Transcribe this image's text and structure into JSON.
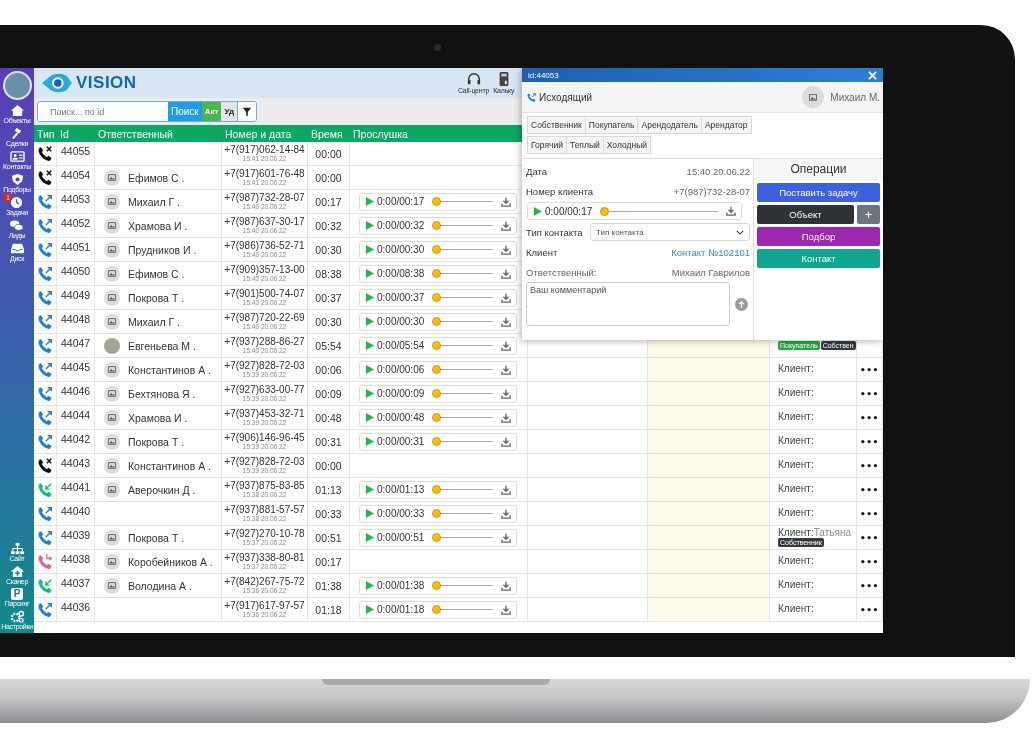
{
  "sidebar": {
    "top_items": [
      {
        "label": "Объекты",
        "kind": "house"
      },
      {
        "label": "Сделки",
        "kind": "hammer"
      },
      {
        "label": "Контакты",
        "kind": "card"
      },
      {
        "label": "Подборы",
        "kind": "shield"
      },
      {
        "label": "Задачи",
        "kind": "clock",
        "badge": "1"
      },
      {
        "label": "Лиды",
        "kind": "chat"
      },
      {
        "label": "Диск",
        "kind": "tray"
      }
    ],
    "bottom_items": [
      {
        "label": "Сайт",
        "kind": "sitemap"
      },
      {
        "label": "Сканер",
        "kind": "house-plus"
      },
      {
        "label": "Парсинг",
        "kind": "letter",
        "glyph": "P"
      },
      {
        "label": "Настройки",
        "kind": "gears"
      }
    ]
  },
  "header": {
    "logo": "VISION",
    "tools": [
      {
        "label": "Call-центр",
        "kind": "headset"
      },
      {
        "label": "Кальку",
        "kind": "calculator"
      }
    ]
  },
  "search": {
    "placeholder": "Поиск... по id",
    "buttons": [
      {
        "label": "Поиск",
        "kind": "search"
      },
      {
        "label": "Акт",
        "kind": "active"
      },
      {
        "label": "Уд",
        "kind": "deleted"
      }
    ]
  },
  "table": {
    "columns": [
      "Тип",
      "Id",
      "Ответственный",
      "Номер и дата",
      "Время",
      "Прослушка"
    ],
    "rows": [
      {
        "kind": "missed",
        "id": "44055",
        "phone": "+7(917)062-14-84",
        "date": "15:41 20.06.22",
        "duration": "00:00"
      },
      {
        "kind": "missed",
        "id": "44054",
        "avatar": {
          "kind": "placeholder"
        },
        "responsible": "Ефимов С .",
        "phone": "+7(917)601-76-48",
        "date": "15:41 20.06.22",
        "duration": "00:00"
      },
      {
        "kind": "outgoing",
        "id": "44053",
        "avatar": {
          "kind": "placeholder"
        },
        "responsible": "Михаил Г .",
        "phone": "+7(987)732-28-07",
        "date": "15:40 20.06.22",
        "duration": "00:17",
        "player": {
          "time": "0:00/00:17",
          "level": 0
        }
      },
      {
        "kind": "outgoing",
        "id": "44052",
        "avatar": {
          "kind": "placeholder"
        },
        "responsible": "Храмова И .",
        "phone": "+7(987)637-30-17",
        "date": "15:40 20.06.22",
        "duration": "00:32",
        "player": {
          "time": "0:00/00:32",
          "level": 0
        }
      },
      {
        "kind": "outgoing",
        "id": "44051",
        "avatar": {
          "kind": "placeholder"
        },
        "responsible": "Прудников И .",
        "phone": "+7(986)736-52-71",
        "date": "15:40 20.06.22",
        "duration": "00:30",
        "player": {
          "time": "0:00/00:30",
          "level": 0
        }
      },
      {
        "kind": "outgoing",
        "id": "44050",
        "avatar": {
          "kind": "placeholder"
        },
        "responsible": "Ефимов С .",
        "phone": "+7(909)357-13-00",
        "date": "15:40 20.06.22",
        "duration": "08:38",
        "player": {
          "time": "0:00/08:38",
          "level": 0
        }
      },
      {
        "kind": "outgoing",
        "id": "44049",
        "avatar": {
          "kind": "placeholder"
        },
        "responsible": "Покрова Т .",
        "phone": "+7(901)500-74-07",
        "date": "15:40 20.06.22",
        "duration": "00:37",
        "player": {
          "time": "0:00/00:37",
          "level": 0
        }
      },
      {
        "kind": "outgoing",
        "id": "44048",
        "avatar": {
          "kind": "placeholder"
        },
        "responsible": "Михаил Г .",
        "phone": "+7(987)720-22-69",
        "date": "15:40 20.06.22",
        "duration": "00:30",
        "player": {
          "time": "0:00/00:30",
          "level": 0
        }
      },
      {
        "kind": "outgoing",
        "id": "44047",
        "avatar": {
          "kind": "photo"
        },
        "responsible": "Евгеньева М .",
        "phone": "+7(937)288-86-27",
        "date": "15:40 20.06.22",
        "duration": "05:54",
        "player": {
          "time": "0:00/05:54",
          "level": 0
        },
        "client": {
          "tags": [
            {
              "text": "Покупатель",
              "color": "#28a745"
            },
            {
              "text": "Собствен",
              "color": "#343a40"
            }
          ]
        }
      },
      {
        "kind": "outgoing",
        "id": "44045",
        "avatar": {
          "kind": "placeholder"
        },
        "responsible": "Константинов А .",
        "phone": "+7(927)828-72-03",
        "date": "15:39 20.06.22",
        "duration": "00:06",
        "player": {
          "time": "0:00/00:06",
          "level": 0
        },
        "client": {
          "label": "Клиент:"
        },
        "menu": "•••"
      },
      {
        "kind": "outgoing",
        "id": "44046",
        "avatar": {
          "kind": "placeholder"
        },
        "responsible": "Бехтянова Я .",
        "phone": "+7(927)633-00-77",
        "date": "15:39 20.06.22",
        "duration": "00:09",
        "player": {
          "time": "0:00/00:09",
          "level": 0
        },
        "client": {
          "label": "Клиент:"
        },
        "menu": "•••"
      },
      {
        "kind": "outgoing",
        "id": "44044",
        "avatar": {
          "kind": "placeholder"
        },
        "responsible": "Храмова И .",
        "phone": "+7(937)453-32-71",
        "date": "15:39 20.06.22",
        "duration": "00:48",
        "player": {
          "time": "0:00/00:48",
          "level": 0
        },
        "client": {
          "label": "Клиент:"
        },
        "menu": "•••"
      },
      {
        "kind": "outgoing",
        "id": "44042",
        "avatar": {
          "kind": "placeholder"
        },
        "responsible": "Покрова Т .",
        "phone": "+7(906)146-96-45",
        "date": "15:39 20.06.22",
        "duration": "00:31",
        "player": {
          "time": "0:00/00:31",
          "level": 0
        },
        "client": {
          "label": "Клиент:"
        },
        "menu": "•••"
      },
      {
        "kind": "missed",
        "id": "44043",
        "avatar": {
          "kind": "placeholder"
        },
        "responsible": "Константинов А .",
        "phone": "+7(927)828-72-03",
        "date": "15:39 20.06.22",
        "duration": "00:00",
        "client": {
          "label": "Клиент:"
        },
        "menu": "•••"
      },
      {
        "kind": "incoming",
        "id": "44041",
        "avatar": {
          "kind": "placeholder"
        },
        "responsible": "Аверочкин Д .",
        "phone": "+7(937)875-83-85",
        "date": "15:38 20.06.22",
        "duration": "01:13",
        "player": {
          "time": "0:00/01:13",
          "level": 0
        },
        "client": {
          "label": "Клиент:"
        },
        "menu": "•••"
      },
      {
        "kind": "outgoing",
        "id": "44040",
        "phone": "+7(937)881-57-57",
        "date": "15:38 20.06.22",
        "duration": "00:33",
        "player": {
          "time": "0:00/00:33",
          "level": 0
        },
        "client": {
          "label": "Клиент:"
        },
        "menu": "•••"
      },
      {
        "kind": "outgoing",
        "id": "44039",
        "avatar": {
          "kind": "placeholder"
        },
        "responsible": "Покрова Т .",
        "phone": "+7(927)270-10-78",
        "date": "15:37 20.06.22",
        "duration": "00:51",
        "player": {
          "time": "0:00/00:51",
          "level": 0
        },
        "client": {
          "label": "Клиент:",
          "name": "Татьяна",
          "tags": [
            {
              "text": "Собственник",
              "color": "#343a40"
            }
          ]
        },
        "menu": "•••"
      },
      {
        "kind": "redirected",
        "id": "44038",
        "avatar": {
          "kind": "placeholder"
        },
        "responsible": "Коробейников А .",
        "phone": "+7(937)338-80-81",
        "date": "15:37 20.06.22",
        "duration": "00:17",
        "client": {
          "label": "Клиент:"
        },
        "menu": "•••"
      },
      {
        "kind": "incoming",
        "id": "44037",
        "avatar": {
          "kind": "placeholder"
        },
        "responsible": "Володина А .",
        "phone": "+7(842)267-75-72",
        "date": "15:36 20.06.22",
        "duration": "01:38",
        "player": {
          "time": "0:00/01:38",
          "level": 0
        },
        "client": {
          "label": "Клиент:"
        },
        "menu": "•••"
      },
      {
        "kind": "outgoing",
        "id": "44036",
        "phone": "+7(917)617-97-57",
        "date": "15:36 20.06.22",
        "duration": "01:18",
        "player": {
          "time": "0:00/01:18",
          "level": 0
        },
        "client": {
          "label": "Клиент:"
        },
        "menu": "•••"
      }
    ]
  },
  "call_card": {
    "title": "id:44053",
    "direction": "Исходящий",
    "agent": "Михаил М.",
    "tag_rows": [
      [
        "Собственник",
        "Покупатель",
        "Арендодатель",
        "Арендатор"
      ],
      [
        "Горячий",
        "Теплый",
        "Холодный"
      ]
    ],
    "date": {
      "label": "Дата",
      "value": "15:40 20.06.22"
    },
    "number": {
      "label": "Номер клиента",
      "value": "+7(987)732-28-07"
    },
    "player": {
      "time": "0:00/00:17",
      "level": 0
    },
    "contact_type": {
      "label": "Тип контакта",
      "placeholder": "Тип контакта"
    },
    "client": {
      "label": "Клиент",
      "link": "Контакт №102101"
    },
    "responsible": {
      "label": "Ответственный:",
      "value": "Михаил Гаврилов"
    },
    "comment": {
      "placeholder": "Ваш комментарий"
    },
    "operations": {
      "title": "Операции",
      "buttons": [
        {
          "label": "Поставить задачу",
          "color": "#3d5fe0"
        },
        {
          "label": "Объект",
          "color": "#2f3338",
          "add": "+"
        },
        {
          "label": "Подбор",
          "color": "#9c27b0"
        },
        {
          "label": "Контакт",
          "color": "#0fa58f"
        }
      ]
    }
  }
}
